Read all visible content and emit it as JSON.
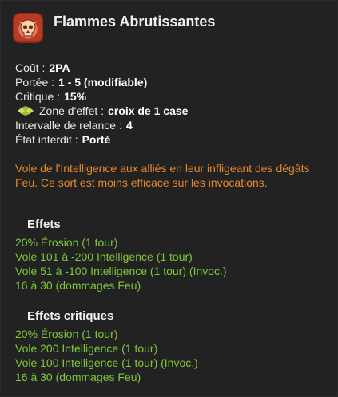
{
  "spell": {
    "title": "Flammes Abrutissantes",
    "icon": "flame-skull-icon"
  },
  "stats": [
    {
      "label": "Coût :",
      "value": "2PA"
    },
    {
      "label": "Portée :",
      "value": "1 - 5 (modifiable)"
    },
    {
      "label": "Critique :",
      "value": "15%"
    },
    {
      "label": "Zone d'effet :",
      "value": "croix de 1 case",
      "icon": "cross-zone-icon"
    },
    {
      "label": "Intervalle de relance :",
      "value": "4"
    },
    {
      "label": "État interdit :",
      "value": "Porté"
    }
  ],
  "description": "Vole de l'Intelligence aux alliés en leur infligeant des dégâts Feu. Ce sort est moins efficace sur les invocations.",
  "effects": {
    "title": "Effets",
    "lines": [
      "20% Érosion (1 tour)",
      "Vole 101 à -200 Intelligence (1 tour)",
      "Vole 51 à -100 Intelligence (1 tour) (Invoc.)",
      "16 à 30 (dommages Feu)"
    ]
  },
  "critical_effects": {
    "title": "Effets critiques",
    "lines": [
      "20% Érosion (1 tour)",
      "Vole 200 Intelligence (1 tour)",
      "Vole 100 Intelligence (1 tour) (Invoc.)",
      "16 à 30 (dommages Feu)"
    ]
  },
  "colors": {
    "background": "#222222",
    "description": "#e8872e",
    "effect": "#7ec83a",
    "zone_icon": "#c8e05a"
  }
}
